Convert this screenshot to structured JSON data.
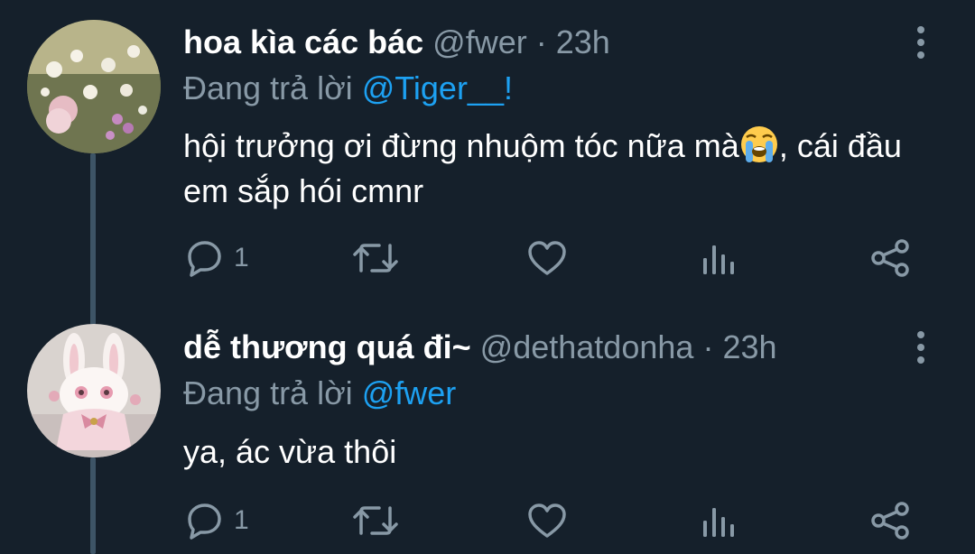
{
  "tweets": [
    {
      "display_name": "hoa kìa các bác",
      "handle": "@fwer",
      "separator": "·",
      "time": "23h",
      "reply_prefix": "Đang trả lời",
      "reply_mention": "@Tiger__!",
      "text_before_emoji": "hội trưởng ơi đừng nhuộm tóc nữa mà",
      "emoji": "loudly-crying-face",
      "text_after_emoji": ", cái đầu em sắp hói cmnr",
      "reply_count": "1",
      "avatar": "flowers-photo"
    },
    {
      "display_name": "dễ thương quá đi~",
      "handle": "@dethatdonha",
      "separator": "·",
      "time": "23h",
      "reply_prefix": "Đang trả lời",
      "reply_mention": "@fwer",
      "text": "ya, ác vừa thôi",
      "reply_count": "1",
      "avatar": "plush-bunny-photo"
    }
  ],
  "icons": {
    "reply": "reply-icon",
    "retweet": "retweet-icon",
    "like": "heart-icon",
    "stats": "analytics-icon",
    "share": "share-icon",
    "more": "more-vertical-icon"
  },
  "colors": {
    "background": "#15202b",
    "mention": "#1da1f2",
    "secondary_text": "#8899a6",
    "thread_line": "#3d5466"
  }
}
